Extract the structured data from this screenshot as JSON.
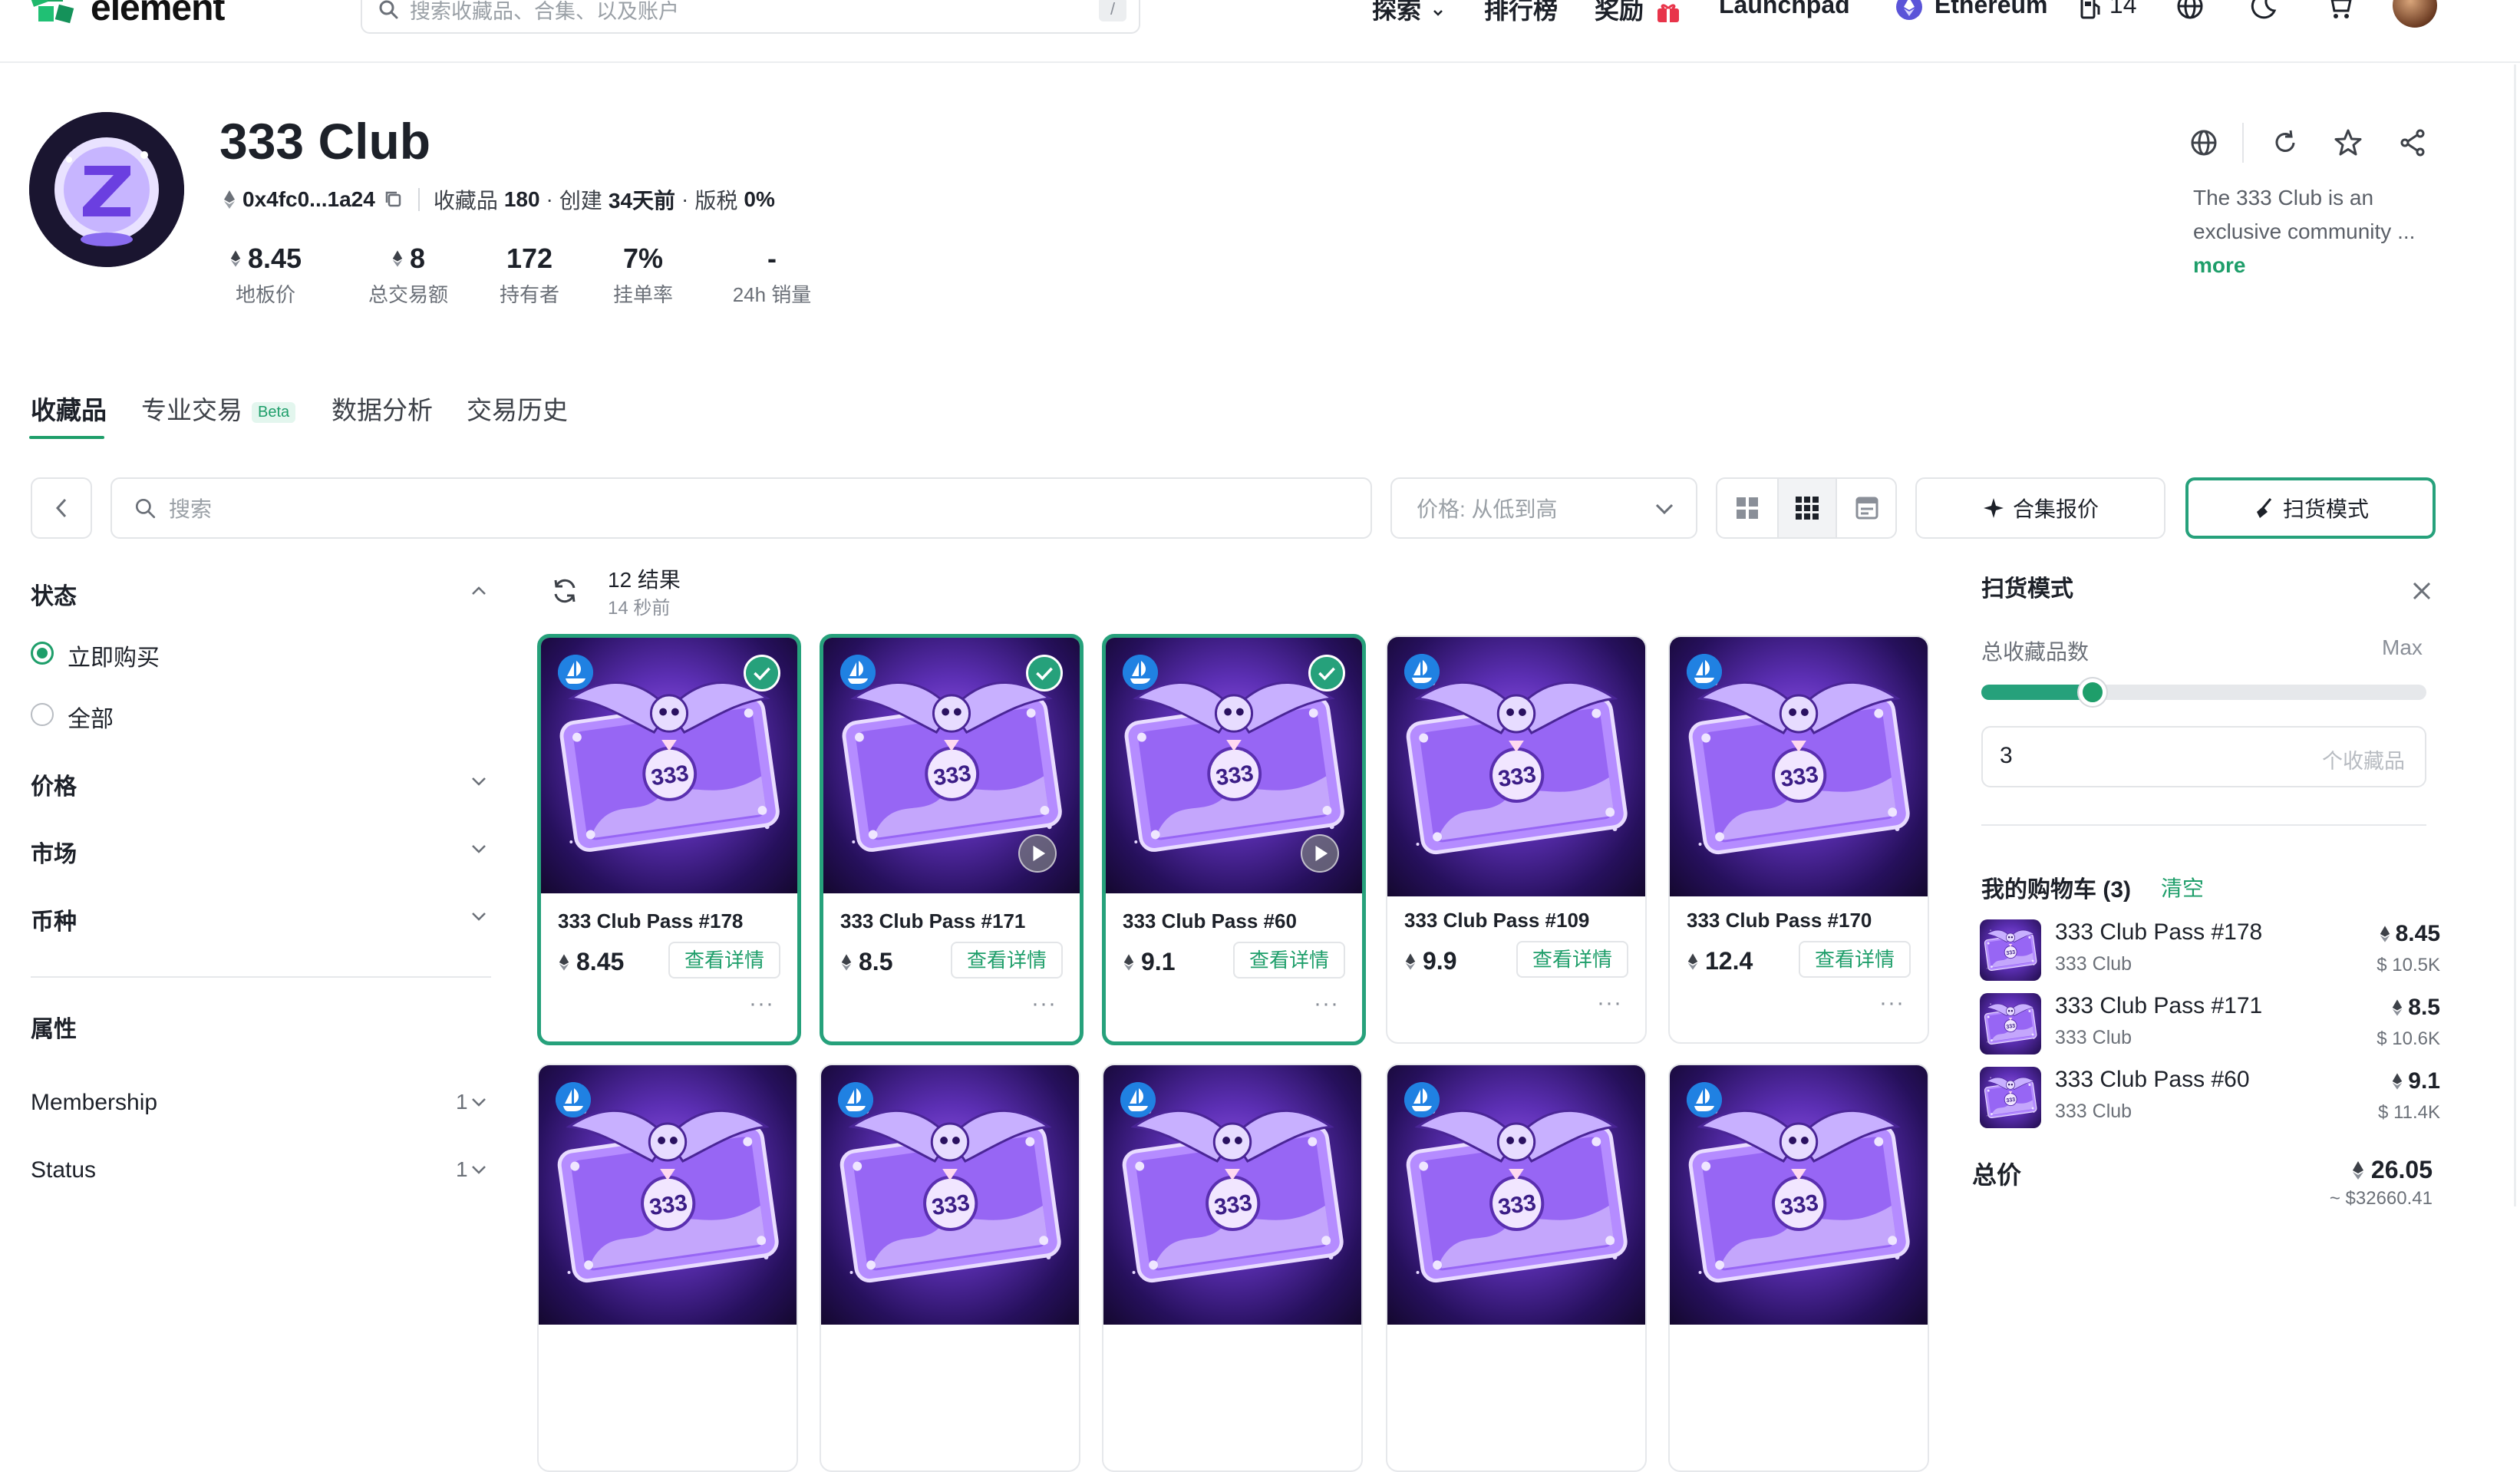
{
  "nav": {
    "logo_text": "element",
    "search_placeholder": "搜索收藏品、合集、以及账户",
    "search_shortcut": "/",
    "explore": "探索",
    "ranking": "排行榜",
    "rewards": "奖励",
    "launchpad": "Launchpad",
    "network": "Ethereum",
    "gas": "14"
  },
  "collection": {
    "name": "333 Club",
    "address": "0x4fc0...1a24",
    "items_label": "收藏品",
    "items_value": "180",
    "created_label": "创建",
    "created_value": "34天前",
    "royalty_label": "版税",
    "royalty_value": "0%",
    "stats": [
      {
        "value": "8.45",
        "label": "地板价",
        "eth": true
      },
      {
        "value": "8",
        "label": "总交易额",
        "eth": true
      },
      {
        "value": "172",
        "label": "持有者",
        "eth": false
      },
      {
        "value": "7%",
        "label": "挂单率",
        "eth": false
      },
      {
        "value": "-",
        "label": "24h 销量",
        "eth": false
      }
    ],
    "description_line1": "The 333 Club is an",
    "description_line2": "exclusive community ...",
    "more": "more"
  },
  "tabs": [
    {
      "label": "收藏品",
      "active": true
    },
    {
      "label": "专业交易",
      "badge": "Beta"
    },
    {
      "label": "数据分析"
    },
    {
      "label": "交易历史"
    }
  ],
  "toolbar": {
    "search_placeholder": "搜索",
    "sort_label": "价格: 从低到高",
    "collection_offer": "合集报价",
    "sweep_mode": "扫货模式"
  },
  "results": {
    "count": "12 结果",
    "updated": "14 秒前"
  },
  "filters": {
    "status": "状态",
    "buy_now": "立即购买",
    "all": "全部",
    "price": "价格",
    "market": "市场",
    "currency": "币种",
    "attributes": "属性",
    "membership": "Membership",
    "membership_count": "1",
    "status_attr": "Status",
    "status_attr_count": "1"
  },
  "cards": [
    {
      "name": "333 Club Pass #178",
      "price": "8.45",
      "detail": "查看详情",
      "selected": true,
      "video": false
    },
    {
      "name": "333 Club Pass #171",
      "price": "8.5",
      "detail": "查看详情",
      "selected": true,
      "video": true
    },
    {
      "name": "333 Club Pass #60",
      "price": "9.1",
      "detail": "查看详情",
      "selected": true,
      "video": true
    },
    {
      "name": "333 Club Pass #109",
      "price": "9.9",
      "detail": "查看详情",
      "selected": false,
      "video": false
    },
    {
      "name": "333 Club Pass #170",
      "price": "12.4",
      "detail": "查看详情",
      "selected": false,
      "video": false
    }
  ],
  "sweep": {
    "title": "扫货模式",
    "total_label": "总收藏品数",
    "max_label": "Max",
    "slider_fraction": 0.25,
    "quantity": "3",
    "quantity_unit": "个收藏品",
    "cart_title": "我的购物车 (3)",
    "clear": "清空",
    "cart": [
      {
        "name": "333 Club Pass #178",
        "sub": "333 Club",
        "price": "8.45",
        "usd": "$ 10.5K"
      },
      {
        "name": "333 Club Pass #171",
        "sub": "333 Club",
        "price": "8.5",
        "usd": "$ 10.6K"
      },
      {
        "name": "333 Club Pass #60",
        "sub": "333 Club",
        "price": "9.1",
        "usd": "$ 11.4K"
      }
    ],
    "total_label2": "总价",
    "total_price": "26.05",
    "total_usd": "~ $32660.41"
  },
  "colors": {
    "accent": "#1e9e6a",
    "opensea": "#2081e2",
    "selected_border": "#26a17b"
  }
}
